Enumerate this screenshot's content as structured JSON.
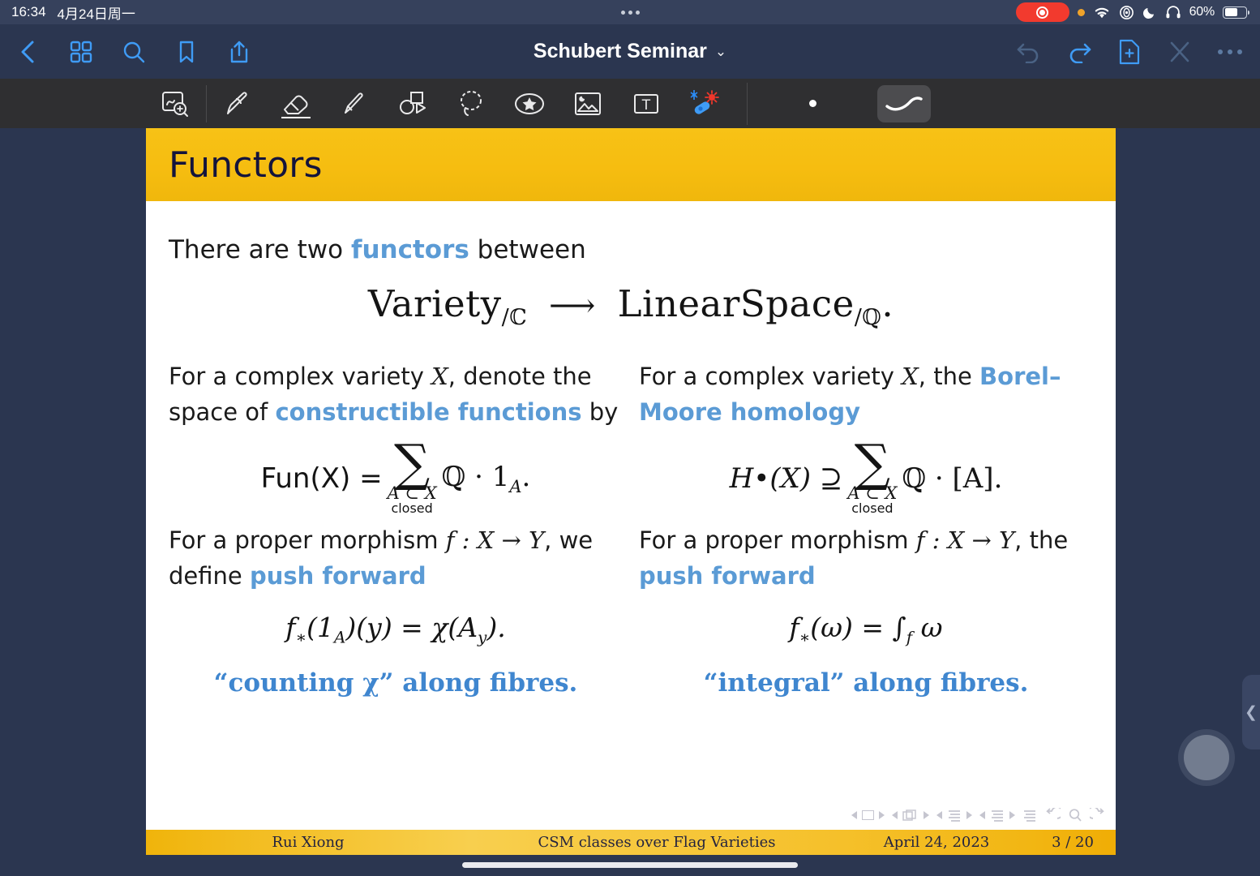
{
  "status_bar": {
    "time": "16:34",
    "date": "4月24日周一",
    "battery_percent": "60%",
    "icons": [
      "screen-recording-pill",
      "orange-privacy-dot",
      "wifi-icon",
      "vpn-icon",
      "do-not-disturb-moon-icon",
      "headphones-icon",
      "battery-icon"
    ]
  },
  "nav_bar": {
    "title": "Schubert Seminar",
    "title_chevron": "⌄",
    "left_icons": [
      "back-chevron-icon",
      "thumbnail-grid-icon",
      "search-icon",
      "bookmark-icon",
      "share-icon"
    ],
    "right_icons": [
      "undo-icon",
      "redo-icon",
      "add-page-icon",
      "close-icon",
      "more-options-icon"
    ]
  },
  "tool_bar": {
    "tools": [
      {
        "name": "zoom-write-icon",
        "selected": false
      },
      {
        "name": "pen-icon",
        "selected": false
      },
      {
        "name": "eraser-icon",
        "selected": true
      },
      {
        "name": "highlighter-icon",
        "selected": false
      },
      {
        "name": "shapes-icon",
        "selected": false
      },
      {
        "name": "lasso-select-icon",
        "selected": false
      },
      {
        "name": "sticker-icon",
        "selected": false
      },
      {
        "name": "insert-image-icon",
        "selected": false
      },
      {
        "name": "text-box-icon",
        "selected": false
      },
      {
        "name": "laser-pointer-icon",
        "selected": false
      }
    ],
    "size_indicator": "small-dot",
    "stroke_preview": "stroke-preview-swatch"
  },
  "slide": {
    "title": "Functors",
    "lead": {
      "before": "There are two ",
      "highlight": "functors",
      "after": " between"
    },
    "main_display": {
      "left_name": "Variety",
      "left_sub": "/ℂ",
      "arrow": "⟶",
      "right_name": "LinearSpace",
      "right_sub": "/ℚ",
      "period": "."
    },
    "columns": [
      {
        "intro_before": "For a complex variety ",
        "intro_var": "X",
        "intro_mid": ", denote the space of ",
        "intro_highlight": "constructible functions",
        "intro_after": " by",
        "formula_lhs": "Fun(X) =",
        "formula_sum_sign": "∑",
        "formula_sum_under": "A ⊂ X",
        "formula_sum_under2": "closed",
        "formula_rhs": "ℚ · 1",
        "formula_rhs_sub": "A",
        "formula_rhs_tail": ".",
        "morphism_before": "For a proper morphism ",
        "morphism_math": "f : X → Y",
        "morphism_mid": ", we define ",
        "morphism_highlight": "push forward",
        "pushforward_formula": "f∗(1A)(y) = χ(Ay).",
        "quote": "“counting χ” along fibres."
      },
      {
        "intro_before": "For a complex variety ",
        "intro_var": "X",
        "intro_mid": ", the ",
        "intro_highlight": "Borel–Moore homology",
        "intro_after": "",
        "formula_lhs": "H•(X) ⊇",
        "formula_sum_sign": "∑",
        "formula_sum_under": "A ⊂ X",
        "formula_sum_under2": "closed",
        "formula_rhs": "ℚ · [A]",
        "formula_rhs_sub": "",
        "formula_rhs_tail": ".",
        "morphism_before": "For a proper morphism ",
        "morphism_math": "f : X → Y",
        "morphism_mid": ", the ",
        "morphism_highlight": "push forward",
        "pushforward_formula": "f∗(ω) = ∫f ω",
        "quote": "“integral” along fibres."
      }
    ],
    "footer": {
      "author": "Rui Xiong",
      "talk_title": "CSM classes over Flag Varieties",
      "date": "April 24, 2023",
      "page": "3 / 20"
    },
    "beamer_nav_icons": [
      "prev-frame-icon",
      "frame-icon",
      "next-frame-icon",
      "prev-subsection-icon",
      "slides-icon",
      "next-subsection-icon",
      "prev-section-icon",
      "toc-icon",
      "next-section-icon",
      "prev-doc-icon",
      "doc-icon",
      "next-doc-icon",
      "full-toc-icon",
      "back-icon",
      "search-icon",
      "forward-icon"
    ]
  },
  "overlays": {
    "side_tab_glyph": "❮",
    "assistive_touch": "assistive-touch-button",
    "home_indicator": "home-indicator"
  },
  "colors": {
    "banner": "#F6BD10",
    "accent_blue": "#5B9BD5",
    "chrome_navy": "#2B3650",
    "toolbar_dark": "#2F2F31"
  }
}
